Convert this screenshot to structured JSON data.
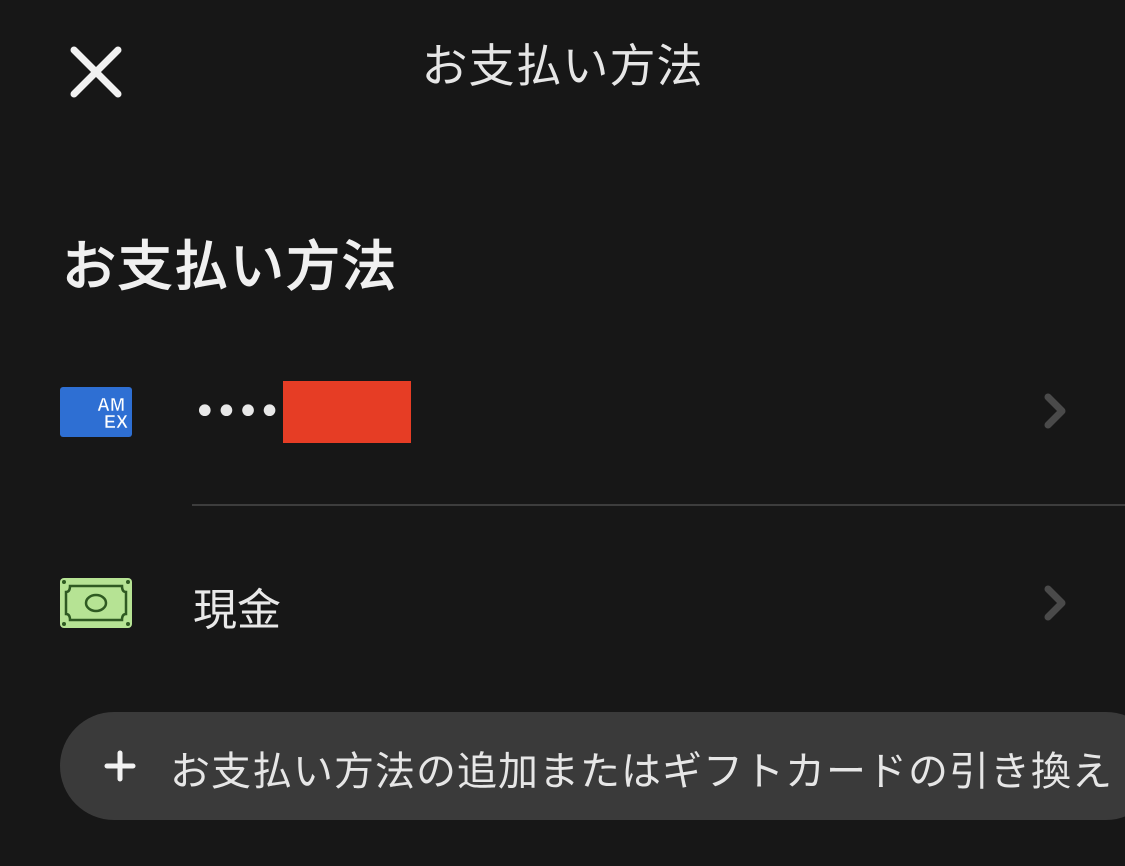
{
  "header": {
    "title": "お支払い方法",
    "close_icon": "close-icon"
  },
  "section": {
    "heading": "お支払い方法"
  },
  "payment_methods": [
    {
      "type": "card",
      "brand": "AMEX",
      "brand_line1": "AM",
      "brand_line2": "EX",
      "masked_number": "••••",
      "icon": "amex-card-icon",
      "color": "#2e6fd3"
    },
    {
      "type": "cash",
      "label": "現金",
      "icon": "cash-icon",
      "color": "#b6e394"
    }
  ],
  "add_button": {
    "label": "お支払い方法の追加またはギフトカードの引き換え",
    "icon": "plus-icon"
  },
  "colors": {
    "background": "#171717",
    "button_bg": "#3a3a3a",
    "redaction": "#e63d25",
    "chevron": "#4a4a4a"
  }
}
